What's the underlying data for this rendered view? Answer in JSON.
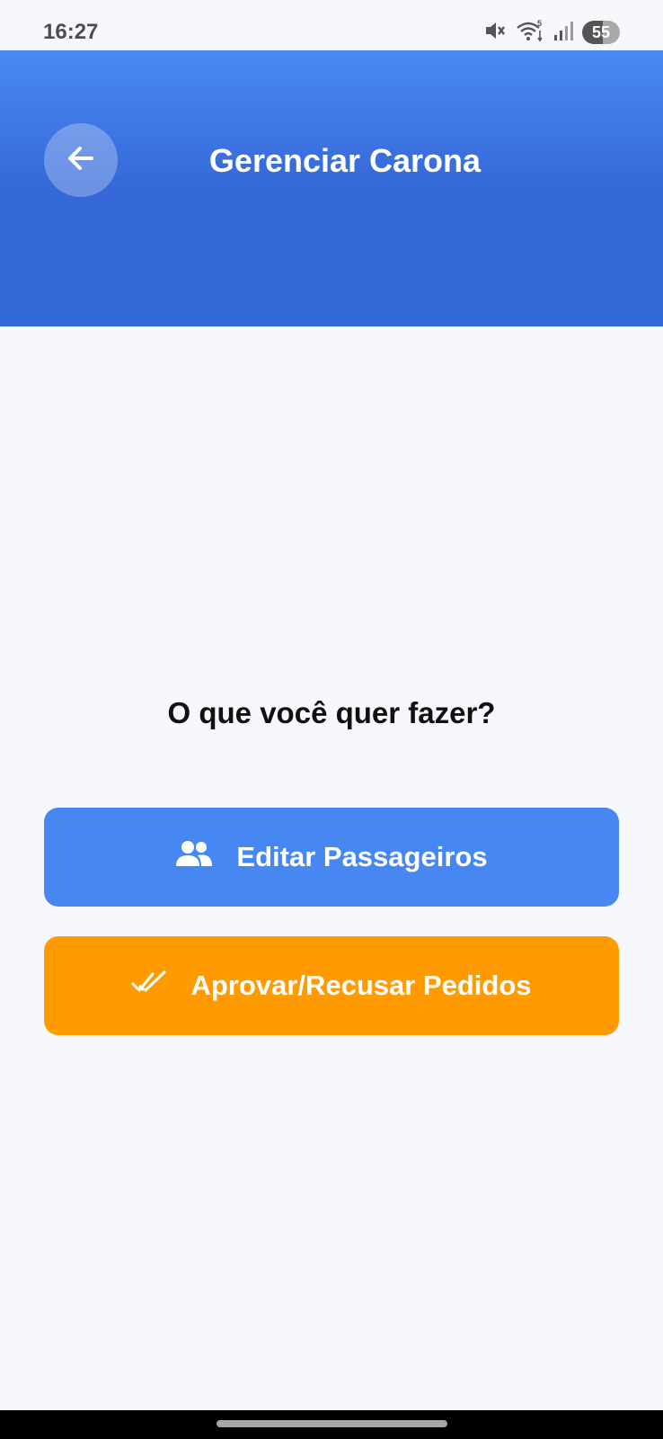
{
  "status_bar": {
    "time": "16:27",
    "battery": "55",
    "icons": [
      "mute-icon",
      "wifi-icon",
      "signal-icon",
      "battery-icon"
    ]
  },
  "header": {
    "title": "Gerenciar Carona",
    "back_icon": "arrow-left-icon",
    "gradient_top": "#4a8af2",
    "gradient_bottom": "#3168d8"
  },
  "main": {
    "prompt": "O que você quer fazer?",
    "actions": [
      {
        "label": "Editar Passageiros",
        "icon": "people-icon",
        "color": "#4787f2"
      },
      {
        "label": "Aprovar/Recusar Pedidos",
        "icon": "double-check-icon",
        "color": "#ff9b00"
      }
    ]
  }
}
